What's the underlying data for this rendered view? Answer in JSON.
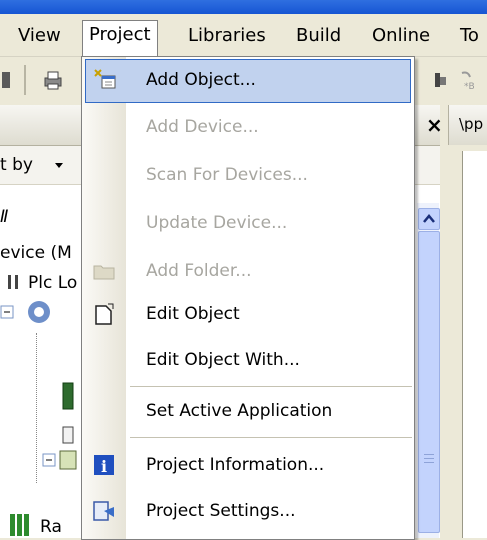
{
  "menubar": {
    "items": [
      {
        "label": "View"
      },
      {
        "label": "Project"
      },
      {
        "label": "Libraries"
      },
      {
        "label": "Build"
      },
      {
        "label": "Online"
      },
      {
        "label": "To"
      }
    ]
  },
  "panel": {
    "close_label": "×",
    "tab_partial": "\\pp",
    "sort_label": "t by",
    "tree": [
      {
        "label": "Ⅱ"
      },
      {
        "label": "evice (M"
      },
      {
        "label": "Plc Lo"
      },
      {
        "label": "Ra"
      }
    ]
  },
  "dropdown": {
    "items": [
      {
        "label": "Add Object...",
        "enabled": true,
        "icon": "add-object-icon"
      },
      {
        "label": "Add Device...",
        "enabled": false,
        "icon": ""
      },
      {
        "label": "Scan For Devices...",
        "enabled": false,
        "icon": ""
      },
      {
        "label": "Update Device...",
        "enabled": false,
        "icon": ""
      },
      {
        "label": "Add Folder...",
        "enabled": false,
        "icon": "folder-icon"
      },
      {
        "label": "Edit Object",
        "enabled": true,
        "icon": "edit-object-icon"
      },
      {
        "label": "Edit Object With...",
        "enabled": true,
        "icon": ""
      },
      {
        "label": "Set Active Application",
        "enabled": true,
        "icon": ""
      },
      {
        "label": "Project Information...",
        "enabled": true,
        "icon": "info-icon"
      },
      {
        "label": "Project Settings...",
        "enabled": true,
        "icon": "project-settings-icon"
      }
    ]
  },
  "colors": {
    "highlight": "#c1d2ee",
    "highlight_border": "#316ac5",
    "disabled_text": "#a7a6a0",
    "info_blue": "#1f4fbf"
  }
}
